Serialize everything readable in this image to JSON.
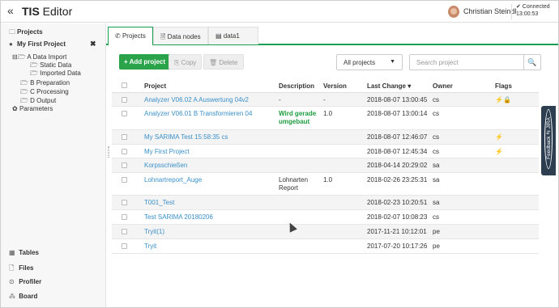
{
  "header": {
    "collapse_icon": "«",
    "app_brand": "TIS",
    "app_name": " Editor",
    "user_name": "Christian Steindl",
    "status": "✔ Connected",
    "status_time": "13:00:53"
  },
  "sidebar": {
    "projects_label": "Projects",
    "current_project": "My First Project",
    "close_icon": "✖",
    "tree": [
      {
        "label": "A Data Import",
        "prefix": "⊟🗁"
      },
      {
        "label": "Static Data",
        "prefix": "🗁"
      },
      {
        "label": "Imported Data",
        "prefix": "🗁"
      },
      {
        "label": "B Preparation",
        "prefix": "🗁"
      },
      {
        "label": "C Processing",
        "prefix": "🗁"
      },
      {
        "label": "D Output",
        "prefix": "🗁"
      },
      {
        "label": "Parameters",
        "prefix": "✿"
      }
    ],
    "bottom": [
      {
        "label": "Tables",
        "icon": "▦"
      },
      {
        "label": "Files",
        "icon": "🗋"
      },
      {
        "label": "Profiler",
        "icon": "⊙"
      },
      {
        "label": "Board",
        "icon": "⁂"
      }
    ]
  },
  "tabs": [
    {
      "label": "Projects",
      "icon": "✆"
    },
    {
      "label": "Data nodes",
      "icon": "🗎"
    },
    {
      "label": "data1",
      "icon": "▤"
    }
  ],
  "toolbar": {
    "add_label": "+ Add project",
    "copy_label": "⎘ Copy",
    "delete_label": "🗑 Delete",
    "filter_value": "All projects",
    "search_placeholder": "Search project",
    "search_icon": "🔍"
  },
  "table": {
    "columns": [
      "Project",
      "Description",
      "Version",
      "Last Change ▾",
      "Owner",
      "Flags"
    ],
    "rows": [
      {
        "project": "Analyzer V06.02 A Auswertung 04v2",
        "description": "-",
        "version": "-",
        "last_change": "2018-08-07 13:00:45",
        "owner": "cs",
        "flags": "⚡🔒"
      },
      {
        "project": "Analyzer V06.01 B Transformieren 04",
        "description": "Wird gerade umgebaut",
        "version": "1.0",
        "last_change": "2018-08-07 13:00:14",
        "owner": "cs",
        "flags": ""
      },
      {
        "project": "My SARIMA Test 15:58:35 cs",
        "description": "",
        "version": "",
        "last_change": "2018-08-07 12:46:07",
        "owner": "cs",
        "flags": "⚡"
      },
      {
        "project": "My First Project",
        "description": "",
        "version": "",
        "last_change": "2018-08-07 12:45:34",
        "owner": "cs",
        "flags": "⚡"
      },
      {
        "project": "Korpsschießen",
        "description": "",
        "version": "",
        "last_change": "2018-04-14 20:29:02",
        "owner": "sa",
        "flags": ""
      },
      {
        "project": "Lohnartreport_Auge",
        "description": "Lohnarten Report",
        "version": "1.0",
        "last_change": "2018-02-26 23:25:31",
        "owner": "sa",
        "flags": ""
      },
      {
        "project": "T001_Test",
        "description": "",
        "version": "",
        "last_change": "2018-02-23 10:20:51",
        "owner": "sa",
        "flags": ""
      },
      {
        "project": "Test SARIMA 20180206",
        "description": "",
        "version": "",
        "last_change": "2018-02-07 10:08:23",
        "owner": "cs",
        "flags": ""
      },
      {
        "project": "Tryit(1)",
        "description": "",
        "version": "",
        "last_change": "2017-11-21 10:12:01",
        "owner": "pe",
        "flags": ""
      },
      {
        "project": "Tryit",
        "description": "",
        "version": "",
        "last_change": "2017-07-20 10:17:26",
        "owner": "pe",
        "flags": ""
      }
    ]
  },
  "feedback": {
    "label": "Feedback ⇆ JIRA"
  },
  "colors": {
    "accent": "#1a9f52",
    "link": "#3a8fc8",
    "add_button": "#2aa34a",
    "feedback": "#2c3e50"
  }
}
